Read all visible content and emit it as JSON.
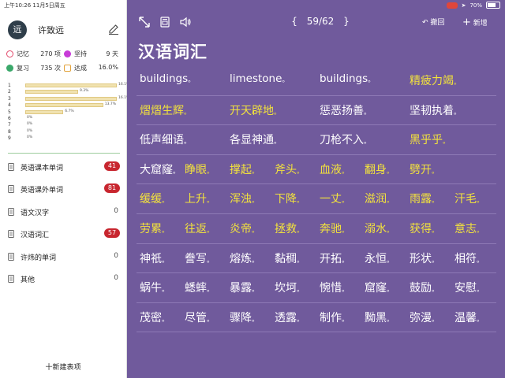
{
  "statusbar": {
    "time": "上午10:26",
    "date": "11月5日周五",
    "battery": "70%",
    "battery_level": 0.7
  },
  "profile": {
    "avatar_text": "远",
    "name": "许致远"
  },
  "stats": [
    {
      "label": "记忆",
      "value": "270 项",
      "color": "#e24a6b"
    },
    {
      "label": "坚持",
      "value": "9 天",
      "color": "#c83cd8"
    },
    {
      "label": "复习",
      "value": "735 次",
      "color": "#3aa86a"
    },
    {
      "label": "达成",
      "value": "16.0%",
      "color": "#e2a23a"
    }
  ],
  "levels": [
    {
      "idx": "1",
      "pct": "16.1%",
      "value": 16.1
    },
    {
      "idx": "2",
      "pct": "9.3%",
      "value": 9.3
    },
    {
      "idx": "3",
      "pct": "16.1%",
      "value": 16.1
    },
    {
      "idx": "4",
      "pct": "13.7%",
      "value": 13.7
    },
    {
      "idx": "5",
      "pct": "6.7%",
      "value": 6.7
    },
    {
      "idx": "6",
      "pct": "0%",
      "value": 0
    },
    {
      "idx": "7",
      "pct": "0%",
      "value": 0
    },
    {
      "idx": "8",
      "pct": "0%",
      "value": 0
    },
    {
      "idx": "9",
      "pct": "0%",
      "value": 0
    }
  ],
  "lists": [
    {
      "name": "英语课本单词",
      "count": "41",
      "badge": true
    },
    {
      "name": "英语课外单词",
      "count": "81",
      "badge": true
    },
    {
      "name": "语文汉字",
      "count": "0",
      "badge": false
    },
    {
      "name": "汉语词汇",
      "count": "57",
      "badge": true
    },
    {
      "name": "许炜的单词",
      "count": "0",
      "badge": false
    },
    {
      "name": "其他",
      "count": "0",
      "badge": false
    }
  ],
  "new_list_label": "十新建表项",
  "toolbar": {
    "open_brace": "{",
    "position": "59/62",
    "close_brace": "}",
    "undo": "撤回",
    "add": "新增"
  },
  "title": "汉语词汇",
  "rows": [
    [
      {
        "t": "buildings",
        "y": false,
        "en": true
      },
      {
        "t": "limestone",
        "y": false,
        "en": true
      },
      {
        "t": "buildings",
        "y": false,
        "en": true
      },
      {
        "t": "精疲力竭",
        "y": true
      }
    ],
    [
      {
        "t": "熠熠生辉",
        "y": true
      },
      {
        "t": "开天辟地",
        "y": true
      },
      {
        "t": "惩恶扬善",
        "y": false
      },
      {
        "t": "坚韧执着",
        "y": false
      }
    ],
    [
      {
        "t": "低声细语",
        "y": false
      },
      {
        "t": "各显神通",
        "y": false
      },
      {
        "t": "刀枪不入",
        "y": false
      },
      {
        "t": "黑乎乎",
        "y": true
      }
    ],
    [
      {
        "t": "大窟窿",
        "y": false
      },
      {
        "t": "睁眼",
        "y": true
      },
      {
        "t": "撑起",
        "y": true
      },
      {
        "t": "斧头",
        "y": true
      },
      {
        "t": "血液",
        "y": true
      },
      {
        "t": "翻身",
        "y": true
      },
      {
        "t": "劈开",
        "y": true
      }
    ],
    [
      {
        "t": "缓缓",
        "y": true
      },
      {
        "t": "上升",
        "y": true
      },
      {
        "t": "浑浊",
        "y": true
      },
      {
        "t": "下降",
        "y": true
      },
      {
        "t": "一丈",
        "y": true
      },
      {
        "t": "滋润",
        "y": true
      },
      {
        "t": "雨露",
        "y": true
      },
      {
        "t": "汗毛",
        "y": true
      }
    ],
    [
      {
        "t": "劳累",
        "y": true
      },
      {
        "t": "往返",
        "y": true
      },
      {
        "t": "炎帝",
        "y": true
      },
      {
        "t": "拯救",
        "y": true
      },
      {
        "t": "奔驰",
        "y": true
      },
      {
        "t": "溺水",
        "y": true
      },
      {
        "t": "获得",
        "y": true
      },
      {
        "t": "意志",
        "y": true
      }
    ],
    [
      {
        "t": "神祇",
        "y": false
      },
      {
        "t": "誊写",
        "y": false
      },
      {
        "t": "熔炼",
        "y": false
      },
      {
        "t": "黏稠",
        "y": false
      },
      {
        "t": "开拓",
        "y": false
      },
      {
        "t": "永恒",
        "y": false
      },
      {
        "t": "形状",
        "y": false
      },
      {
        "t": "相符",
        "y": false
      }
    ],
    [
      {
        "t": "蜗牛",
        "y": false
      },
      {
        "t": "蟋蟀",
        "y": false
      },
      {
        "t": "暴露",
        "y": false
      },
      {
        "t": "坎坷",
        "y": false
      },
      {
        "t": "惋惜",
        "y": false
      },
      {
        "t": "窟窿",
        "y": false
      },
      {
        "t": "鼓励",
        "y": false
      },
      {
        "t": "安慰",
        "y": false
      }
    ],
    [
      {
        "t": "茂密",
        "y": false
      },
      {
        "t": "尽管",
        "y": false
      },
      {
        "t": "骤降",
        "y": false
      },
      {
        "t": "透露",
        "y": false
      },
      {
        "t": "制作",
        "y": false
      },
      {
        "t": "黝黑",
        "y": false
      },
      {
        "t": "弥漫",
        "y": false
      },
      {
        "t": "温馨",
        "y": false
      }
    ]
  ],
  "separator": "。"
}
